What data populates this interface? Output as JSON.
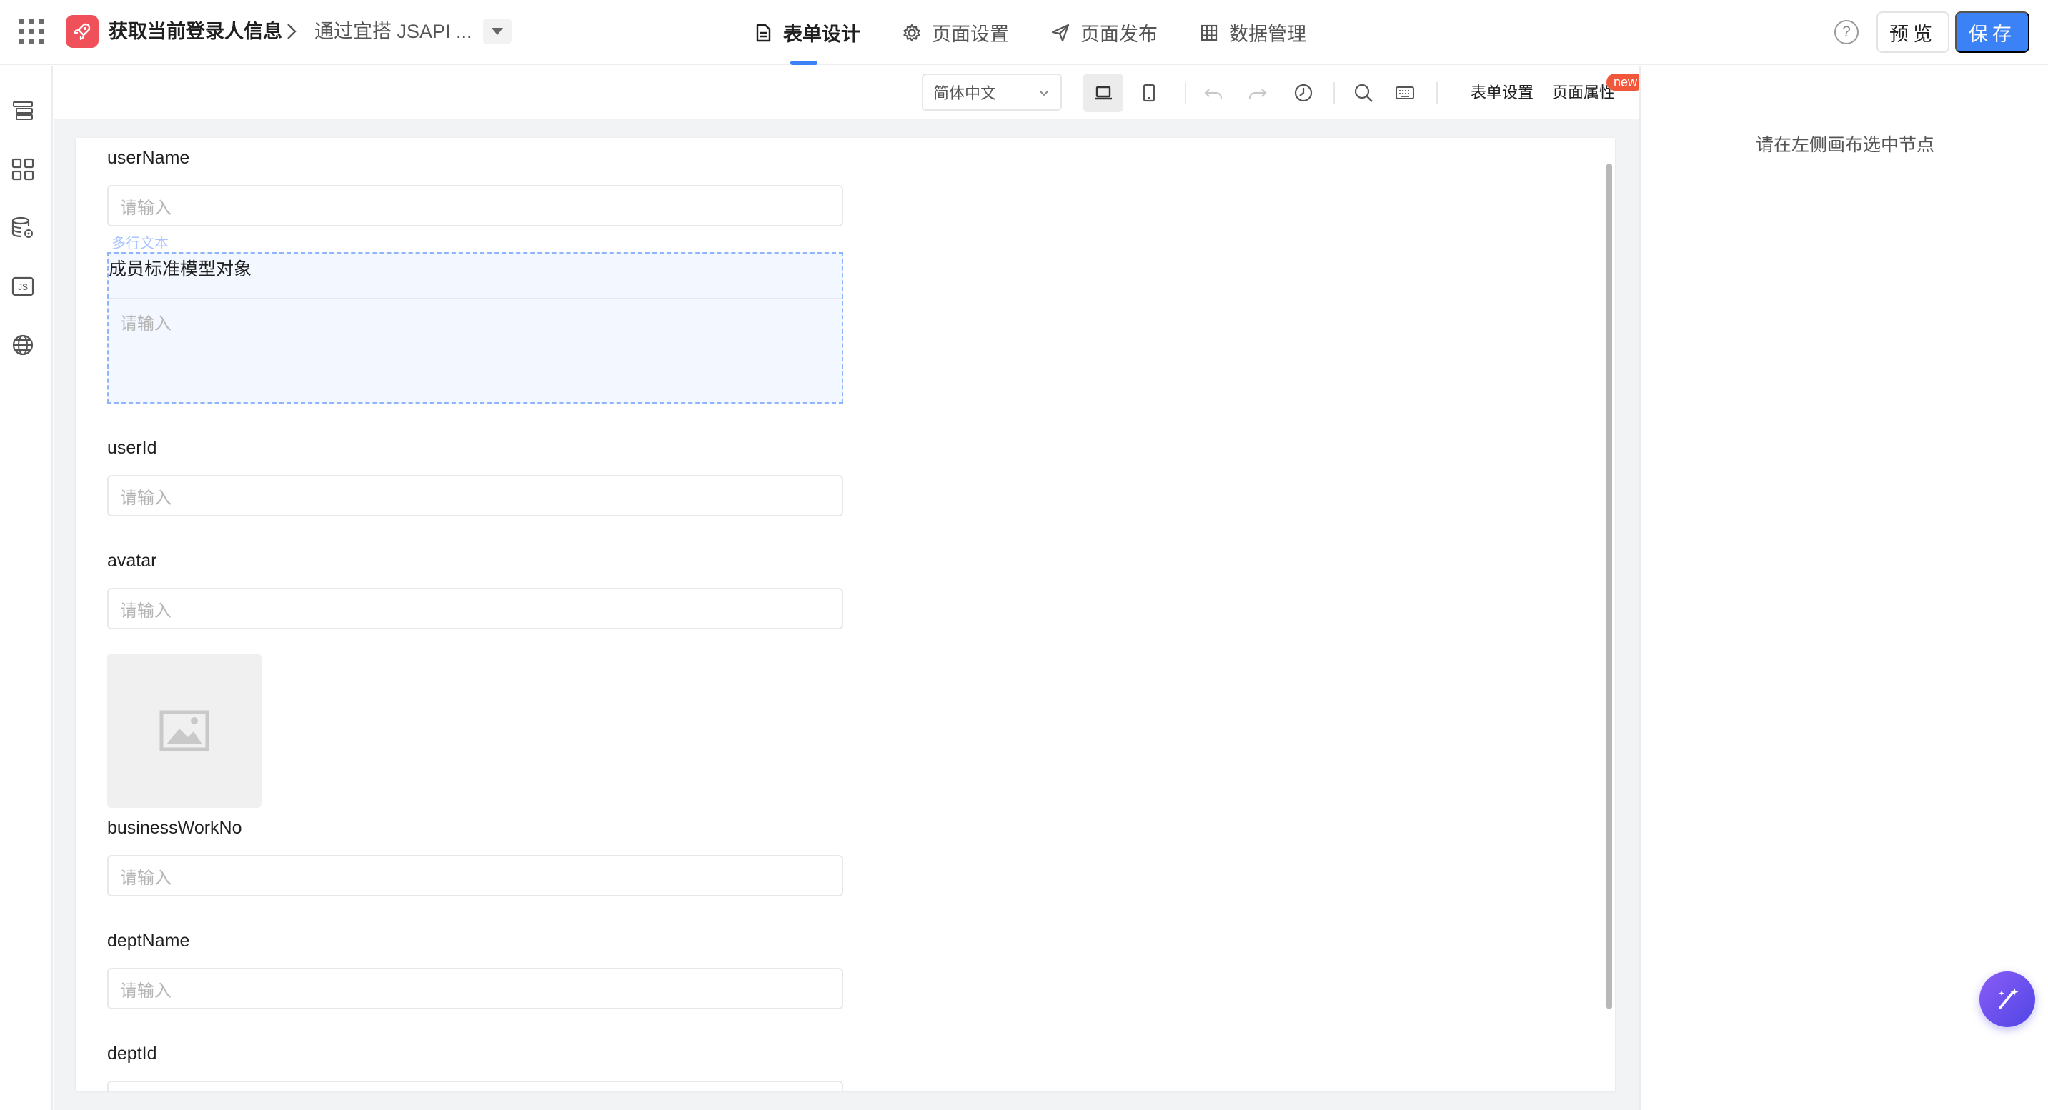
{
  "header": {
    "app_title": "获取当前登录人信息",
    "page_name": "通过宜搭 JSAPI ...",
    "tabs": [
      {
        "label": "表单设计",
        "icon": "document-icon",
        "active": true
      },
      {
        "label": "页面设置",
        "icon": "gear-icon",
        "active": false
      },
      {
        "label": "页面发布",
        "icon": "send-icon",
        "active": false
      },
      {
        "label": "数据管理",
        "icon": "table-icon",
        "active": false
      }
    ],
    "help_glyph": "?",
    "preview_label": "预览",
    "save_label": "保存",
    "accent_color": "#3b82f6"
  },
  "left_rail": {
    "icons": [
      "outline-tree-icon",
      "components-grid-icon",
      "data-source-icon",
      "js-code-icon",
      "globe-icon"
    ]
  },
  "toolbar": {
    "language": "简体中文",
    "form_settings_label": "表单设置",
    "page_properties_label": "页面属性",
    "new_badge": "new"
  },
  "form": {
    "placeholder": "请输入",
    "selected_tag": "多行文本",
    "fields": [
      {
        "label": "userName",
        "type": "text"
      },
      {
        "label": "成员标准模型对象",
        "type": "textarea"
      },
      {
        "label": "userId",
        "type": "text"
      },
      {
        "label": "avatar",
        "type": "text"
      },
      {
        "label": "businessWorkNo",
        "type": "text"
      },
      {
        "label": "deptName",
        "type": "text"
      },
      {
        "label": "deptId",
        "type": "text"
      }
    ]
  },
  "right_panel": {
    "hint": "请在左侧画布选中节点"
  }
}
